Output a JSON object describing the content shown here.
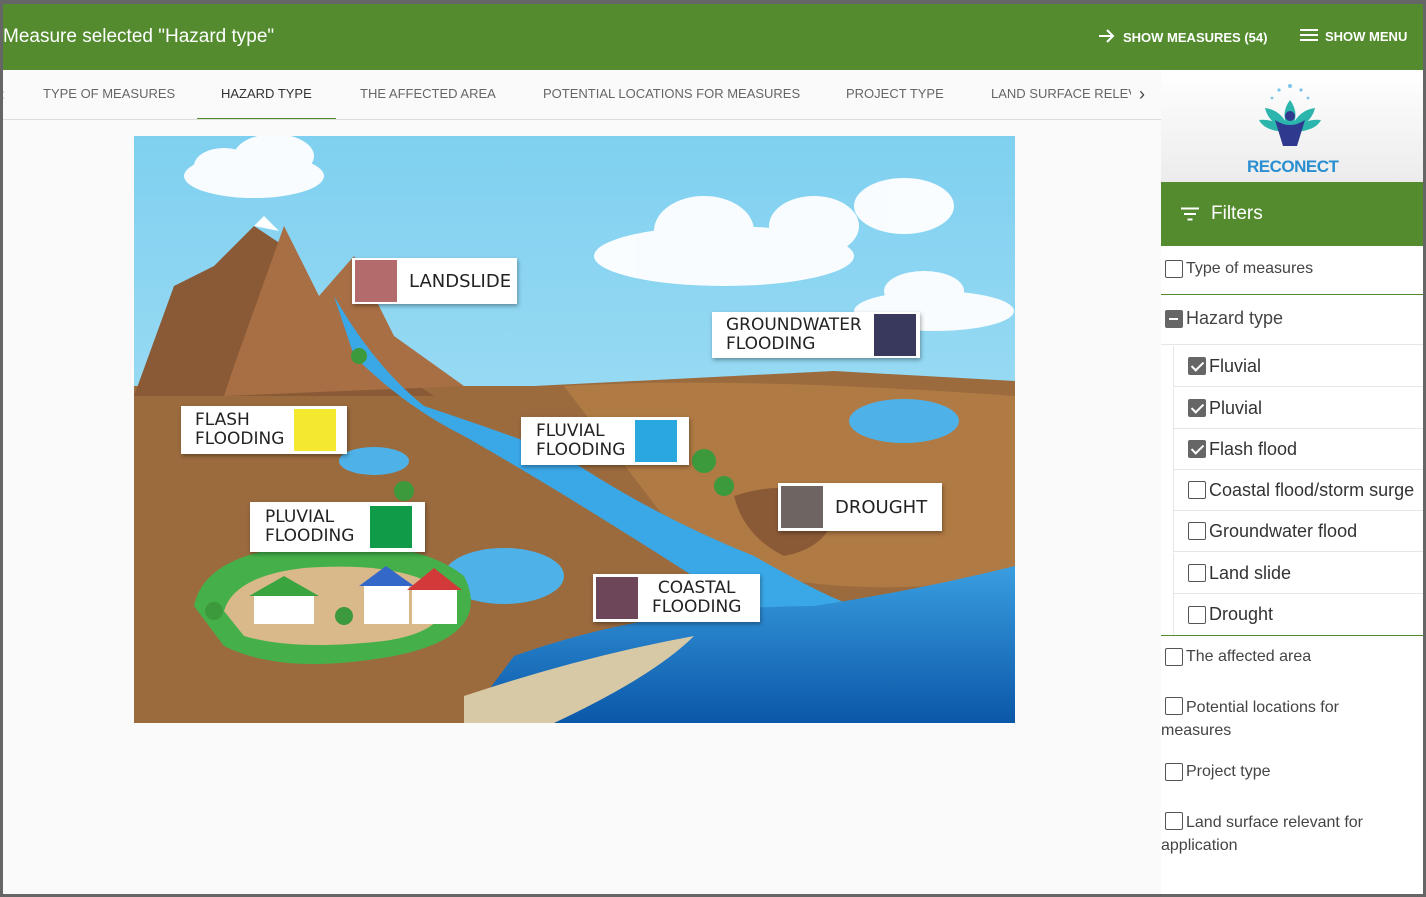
{
  "header": {
    "title": "Measure selected \"Hazard type\"",
    "show_measures": "SHOW MEASURES (54)",
    "show_menu": "SHOW MENU",
    "color": "#548b2f"
  },
  "tabs": [
    {
      "label": "TYPE OF MEASURES"
    },
    {
      "label": "HAZARD TYPE"
    },
    {
      "label": "THE AFFECTED AREA"
    },
    {
      "label": "POTENTIAL LOCATIONS FOR MEASURES"
    },
    {
      "label": "PROJECT TYPE"
    },
    {
      "label": "LAND SURFACE RELEV"
    }
  ],
  "illustration": {
    "labels": {
      "landslide": {
        "text": "LANDSLIDE",
        "color": "#b46b6b"
      },
      "groundwater": {
        "text": "GROUNDWATER\nFLOODING",
        "color": "#38395c"
      },
      "flash": {
        "text": "FLASH\nFLOODING",
        "color": "#f4e92e"
      },
      "fluvial": {
        "text": "FLUVIAL\nFLOODING",
        "color": "#29a8e0"
      },
      "drought": {
        "text": "DROUGHT",
        "color": "#6e6461"
      },
      "pluvial": {
        "text": "PLUVIAL\nFLOODING",
        "color": "#0f9b47"
      },
      "coastal": {
        "text": "COASTAL\nFLOODING",
        "color": "#6d4759"
      }
    }
  },
  "sidebar": {
    "logo_text": "RECONECT",
    "filters_title": "Filters",
    "items": {
      "type_of_measures": "Type of measures",
      "hazard_type": "Hazard type",
      "affected_area": "The affected area",
      "potential_locations": "Potential locations for measures",
      "project_type": "Project type",
      "land_surface": "Land surface relevant for application"
    },
    "hazard_options": [
      {
        "label": "Fluvial",
        "checked": true
      },
      {
        "label": "Pluvial",
        "checked": true
      },
      {
        "label": "Flash flood",
        "checked": true
      },
      {
        "label": "Coastal flood/storm surge",
        "checked": false
      },
      {
        "label": "Groundwater flood",
        "checked": false
      },
      {
        "label": "Land slide",
        "checked": false
      },
      {
        "label": "Drought",
        "checked": false
      }
    ]
  }
}
